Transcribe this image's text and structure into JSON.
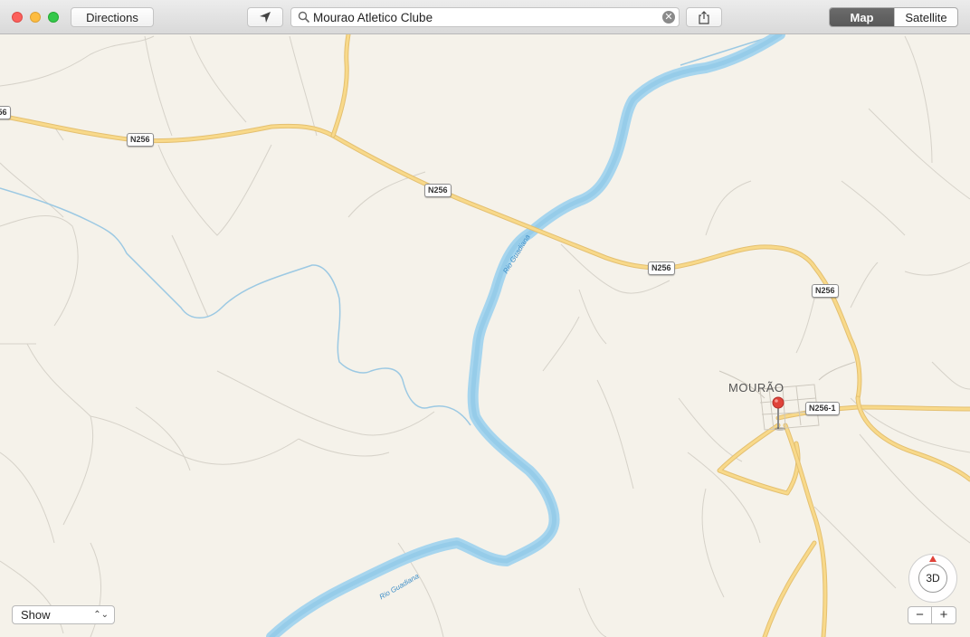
{
  "toolbar": {
    "directions_label": "Directions",
    "search_value": "Mourao Atletico Clube",
    "locate_icon": "location-arrow-icon",
    "share_icon": "share-icon",
    "view_modes": [
      "Map",
      "Satellite"
    ],
    "selected_view": "Map"
  },
  "map": {
    "road_labels": [
      "N256",
      "N256",
      "N256",
      "N256",
      "N256-1"
    ],
    "town_label": "MOURÃO",
    "river_labels": [
      "Rio Guadiana",
      "Rio Guadiana"
    ],
    "pin_color": "#e0433a",
    "road_color": "#f6cf6a",
    "river_color": "#a6d5ee",
    "land_color": "#f5f2ea"
  },
  "controls": {
    "show_label": "Show",
    "compass_label": "3D",
    "zoom_out_label": "−",
    "zoom_in_label": "+"
  }
}
